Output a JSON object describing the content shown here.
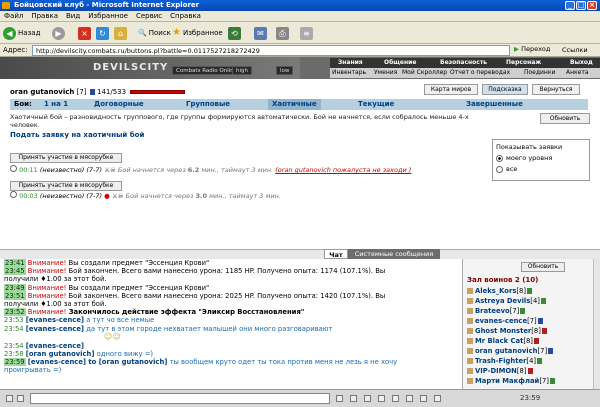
{
  "window": {
    "title": "Бойцовский клуб - Microsoft Internet Explorer"
  },
  "menu": [
    "Файл",
    "Правка",
    "Вид",
    "Избранное",
    "Сервис",
    "Справка"
  ],
  "toolbar": {
    "back": "Назад",
    "search": "Поиск",
    "favorites": "Избранное"
  },
  "address": {
    "label": "Адрес:",
    "url": "http://devilscity.combats.ru/buttons.pl?battle=0.0117527218272429",
    "go": "Переход",
    "links": "Ссылки"
  },
  "game": {
    "logo_name": "DEVILSCITY",
    "radio": "Combats Radio Online",
    "quality_high": "high",
    "quality_low": "low",
    "topnav": [
      "Знания",
      "Общение",
      "Безопасность",
      "Персонаж",
      "Выход"
    ],
    "subnav": [
      "Инвентарь",
      "Умения",
      "Мой Скроллер",
      "Отчет о переводах",
      "Поединки",
      "Анкета"
    ]
  },
  "user": {
    "name": "oran gutanovich",
    "level": "[7]",
    "hp": "141/533"
  },
  "buttons": {
    "map": "Карта миров",
    "hint": "Подсказка",
    "back": "Вернуться",
    "apply": "Обновить",
    "join": "Принять участие в мясорубке",
    "refresh": "Обновить"
  },
  "tabs": {
    "label": "Бои:",
    "items": [
      "1 на 1",
      "Договорные",
      "Групповые",
      "Хаотичные",
      "Текущие",
      "Завершенные"
    ]
  },
  "description": "Хаотичный бой – разновидность группового, где группы формируются автоматически. Бой не начнется, если собралось меньше 4-х человек.",
  "submit_link": "Подать заявку на хаотичный бой",
  "show_box": {
    "title": "Показывать заявки",
    "opt1": "моего уровня",
    "opt2": "все"
  },
  "battles": [
    {
      "time": "00:11",
      "team": "(неизвестно) (7-7)",
      "info": "Бой начнется через",
      "mins": "6.2",
      "rest": "мин., таймаут 3 мин.",
      "comment": "(oran gutanovich пожалуста не заходи )"
    },
    {
      "time": "00:03",
      "team": "(неизвестно) (7-7)",
      "info": "Бой начнется через",
      "mins": "3.0",
      "rest": "мин., таймаут 3 мин."
    }
  ],
  "chat_tabs": {
    "chat": "Чат",
    "system": "Системные сообщения"
  },
  "chat": [
    {
      "ts": "23:41",
      "warn": "Внимание!",
      "text": " Вы создали предмет \"Эссенция Крови\""
    },
    {
      "ts": "23:45",
      "warn": "Внимание!",
      "text": " Бой закончен. Всего вами нанесено урона: 1185 HP. Получено опыта: 1174 (107.1%). Вы"
    },
    {
      "ts": "",
      "warn": "",
      "text": "получили ♦1.00 за этот бой."
    },
    {
      "ts": "23:49",
      "warn": "Внимание!",
      "text": " Вы создали предмет \"Эссенция Крови\""
    },
    {
      "ts": "23:51",
      "warn": "Внимание!",
      "text": " Бой закончен. Всего вами нанесено урона: 2025 HP. Получено опыта: 1420 (107.1%). Вы"
    },
    {
      "ts": "",
      "warn": "",
      "text": "получили ♦1.00 за этот бой."
    },
    {
      "ts": "23:52",
      "warn": "Внимание!",
      "text": " Закончилось действие эффекта \"Эликсир Восстановления\""
    },
    {
      "ts": "23:53",
      "user": "[evanes-cence]",
      "text": " а тут чо все немые"
    },
    {
      "ts": "23:54",
      "user": "[evanes-cence]",
      "text": " да тут в этом городе нехватает малышей они много разговаривают"
    },
    {
      "ts": "23:54",
      "user": "[evanes-cence]",
      "text": ""
    },
    {
      "ts": "23:58",
      "user": "[oran gutanovich]",
      "text": " одного вижу =)"
    },
    {
      "ts": "23:59",
      "user": "[evanes-cence]",
      "to": " to [oran gutanovich]",
      "text": " ты вообщем круто одет ты тока против меня не лезь я не хочу"
    },
    {
      "ts": "",
      "warn": "",
      "text": "проигрывать =)"
    }
  ],
  "roster": {
    "room": "Зал воинов 2 (10)",
    "players": [
      {
        "name": "Aleks_Kors",
        "lvl": "[8]"
      },
      {
        "name": "Astreya Devils",
        "lvl": "[4]"
      },
      {
        "name": "Brateevo",
        "lvl": "[7]"
      },
      {
        "name": "evanes-cence",
        "lvl": "[7]"
      },
      {
        "name": "Ghost Monster",
        "lvl": "[8]"
      },
      {
        "name": "Mr Black Cat",
        "lvl": "[8]"
      },
      {
        "name": "oran gutanovich",
        "lvl": "[7]"
      },
      {
        "name": "Trash-Fighter",
        "lvl": "[4]"
      },
      {
        "name": "VIP-DIMON",
        "lvl": "[8]"
      },
      {
        "name": "Марти Макфлай",
        "lvl": "[7]"
      }
    ]
  },
  "status": {
    "clock": "23:59"
  }
}
